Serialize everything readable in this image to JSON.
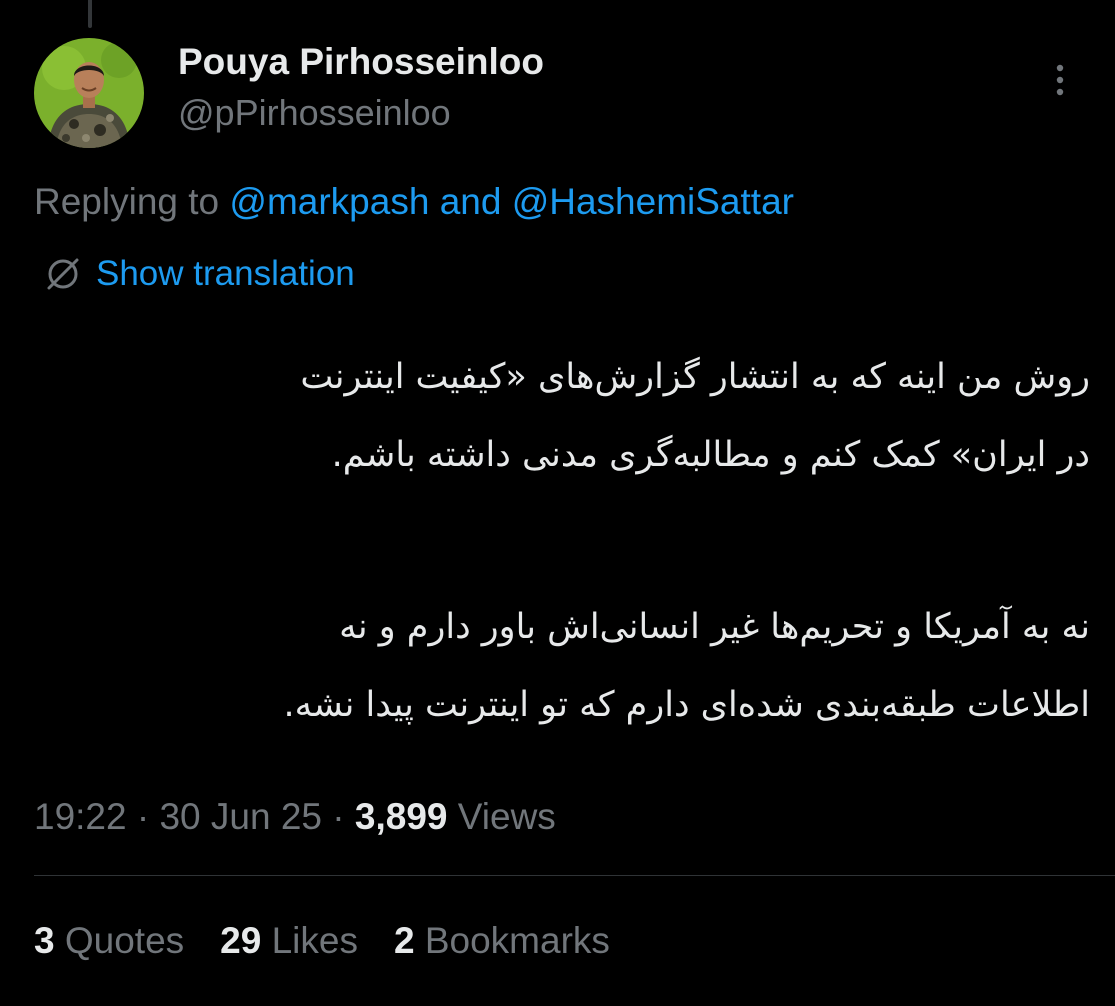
{
  "tweet": {
    "author_name": "Pouya Pirhosseinloo",
    "author_handle": "@pPirhosseinloo",
    "avatar_icon": "user-avatar",
    "more_icon": "more-vertical-icon",
    "reply_prefix": "Replying to",
    "reply_mention_1": "@markpash",
    "reply_and": "and",
    "reply_mention_2": "@HashemiSattar",
    "translate_icon": "globe-icon",
    "translate_label": "Show translation",
    "paragraph_1_line_1": "روش من اینه که به انتشار گزارش‌های «کیفیت اینترنت",
    "paragraph_1_line_2": "در ایران» کمک کنم و مطالبه‌گری مدنی داشته باشم.",
    "paragraph_2_line_1": "نه به آمریکا و تحریم‌ها غیر انسانی‌اش باور دارم و نه",
    "paragraph_2_line_2": "اطلاعات طبقه‌بندی شده‌ای دارم که تو اینترنت پیدا نشه.",
    "time": "19:22",
    "sep": "·",
    "date": "30 Jun 25",
    "views_count": "3,899",
    "views_label": "Views"
  },
  "stats": {
    "quotes_count": "3",
    "quotes_label": "Quotes",
    "likes_count": "29",
    "likes_label": "Likes",
    "bookmarks_count": "2",
    "bookmarks_label": "Bookmarks"
  },
  "colors": {
    "background": "#000000",
    "text_primary": "#e7e9ea",
    "text_secondary": "#71767b",
    "accent": "#1d9bf0",
    "divider": "#2f3336"
  }
}
